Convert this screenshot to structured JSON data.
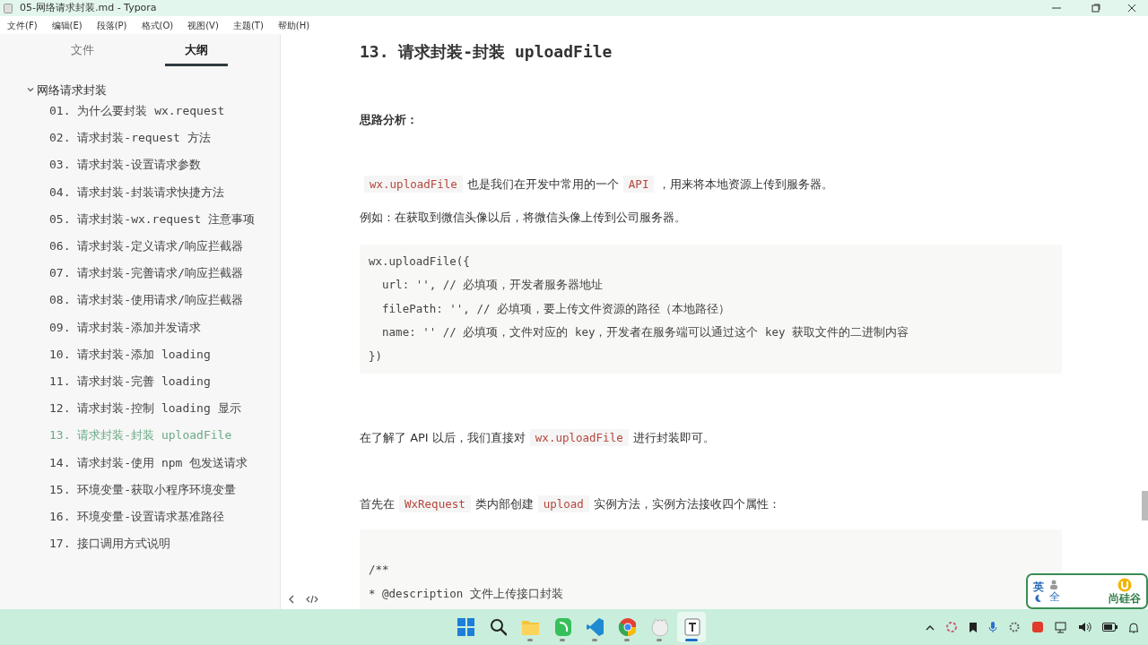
{
  "window": {
    "title": "05-网络请求封装.md - Typora"
  },
  "menu": [
    "文件(F)",
    "编辑(E)",
    "段落(P)",
    "格式(O)",
    "视图(V)",
    "主题(T)",
    "帮助(H)"
  ],
  "sidebar": {
    "tabs": [
      {
        "label": "文件",
        "selected": false
      },
      {
        "label": "大纲",
        "selected": true
      }
    ],
    "outline": [
      {
        "label": "网络请求封装",
        "expanded": true,
        "selected": false,
        "children": [
          {
            "label": "01. 为什么要封装 wx.request",
            "selected": false
          },
          {
            "label": "02. 请求封装-request 方法",
            "selected": false
          },
          {
            "label": "03. 请求封装-设置请求参数",
            "selected": false
          },
          {
            "label": "04. 请求封装-封装请求快捷方法",
            "selected": false
          },
          {
            "label": "05. 请求封装-wx.request 注意事项",
            "selected": false
          },
          {
            "label": "06. 请求封装-定义请求/响应拦截器",
            "selected": false
          },
          {
            "label": "07. 请求封装-完善请求/响应拦截器",
            "selected": false
          },
          {
            "label": "08. 请求封装-使用请求/响应拦截器",
            "selected": false
          },
          {
            "label": "09. 请求封装-添加并发请求",
            "selected": false
          },
          {
            "label": "10. 请求封装-添加 loading",
            "selected": false
          },
          {
            "label": "11. 请求封装-完善 loading",
            "selected": false
          },
          {
            "label": "12. 请求封装-控制 loading 显示",
            "selected": false
          },
          {
            "label": "13. 请求封装-封装 uploadFile",
            "selected": true
          },
          {
            "label": "14. 请求封装-使用 npm 包发送请求",
            "selected": false
          },
          {
            "label": "15. 环境变量-获取小程序环境变量",
            "selected": false
          },
          {
            "label": "16. 环境变量-设置请求基准路径",
            "selected": false
          },
          {
            "label": "17. 接口调用方式说明",
            "selected": false
          }
        ]
      }
    ]
  },
  "document": {
    "blocks": [
      {
        "kind": "heading",
        "text": "13. 请求封装-封装 uploadFile"
      },
      {
        "kind": "strong",
        "text": "思路分析："
      },
      {
        "kind": "paragraph",
        "parts": [
          {
            "kind": "code",
            "text": "wx.uploadFile"
          },
          {
            "kind": "text",
            "text": "也是我们在开发中常用的一个"
          },
          {
            "kind": "code",
            "text": "API"
          },
          {
            "kind": "text",
            "text": "，用来将本地资源上传到服务器。"
          }
        ]
      },
      {
        "kind": "paragraph",
        "parts": [
          {
            "kind": "text",
            "text": "例如：在获取到微信头像以后，将微信头像上传到公司服务器。"
          }
        ]
      },
      {
        "kind": "code_block",
        "lines": [
          "wx.uploadFile({",
          "  url: '', // 必填项，开发者服务器地址",
          "  filePath: '', // 必填项，要上传文件资源的路径（本地路径）",
          "  name: '' // 必填项，文件对应的 key，开发者在服务端可以通过这个 key 获取文件的二进制内容",
          "})"
        ]
      },
      {
        "kind": "paragraph",
        "parts": [
          {
            "kind": "text",
            "text": "在了解了 API 以后，我们直接对"
          },
          {
            "kind": "code",
            "text": "wx.uploadFile"
          },
          {
            "kind": "text",
            "text": "进行封装即可。"
          }
        ]
      },
      {
        "kind": "paragraph",
        "parts": [
          {
            "kind": "text",
            "text": "首先在"
          },
          {
            "kind": "code",
            "text": "WxRequest"
          },
          {
            "kind": "text",
            "text": "类内部创建"
          },
          {
            "kind": "code",
            "text": "upload"
          },
          {
            "kind": "text",
            "text": "实例方法，实例方法接收四个属性："
          }
        ]
      },
      {
        "kind": "code_block",
        "lines": [
          "/**",
          "* @description 文件上传接口封装"
        ]
      }
    ]
  },
  "ime": {
    "mode": "英",
    "width": "全",
    "brand": "尚硅谷"
  },
  "taskbar": {
    "apps": [
      {
        "kind": "start",
        "running": false,
        "active": false
      },
      {
        "kind": "search",
        "running": false,
        "active": false
      },
      {
        "kind": "folder",
        "running": true,
        "active": false
      },
      {
        "kind": "leaf-app",
        "running": true,
        "active": false
      },
      {
        "kind": "vscode",
        "running": true,
        "active": false
      },
      {
        "kind": "chrome",
        "running": true,
        "active": false
      },
      {
        "kind": "cat",
        "running": true,
        "active": false
      },
      {
        "kind": "typora",
        "running": true,
        "active": true
      }
    ]
  }
}
